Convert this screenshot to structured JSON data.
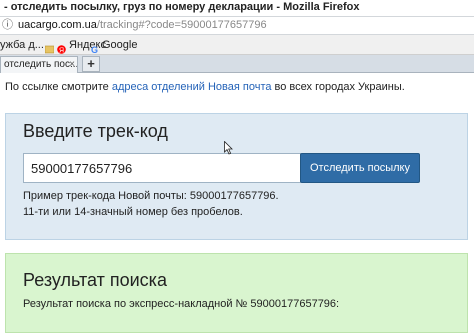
{
  "window": {
    "title": "- отследить посылку, груз по номеру декларации - Mozilla Firefox"
  },
  "address_bar": {
    "host": "uacargo.com.ua",
    "path": "/tracking#?code=59000177657796"
  },
  "bookmarks": {
    "items": [
      {
        "label": "ужба д..."
      },
      {
        "label": "Яндекс"
      },
      {
        "label": "Google"
      }
    ]
  },
  "tabs": {
    "active_label": "отследить пос...",
    "close_glyph": "×",
    "new_tab_glyph": "+"
  },
  "page": {
    "notice_prefix": "По ссылке смотрите ",
    "notice_link": "адреса отделений Новая почта",
    "notice_suffix": " во всех городах Украины.",
    "track": {
      "title": "Введите трек-код",
      "input_value": "59000177657796",
      "button_label": "Отследить посылку",
      "hint_line1": "Пример трек-кода Новой почты: 59000177657796.",
      "hint_line2": "11-ти или 14-значный номер без пробелов."
    },
    "result": {
      "title": "Результат поиска",
      "text": "Результат поиска по экспресс-накладной № 59000177657796:"
    }
  },
  "colors": {
    "track_panel_bg": "#dfeaf3",
    "result_panel_bg": "#d9f5cf",
    "button_bg": "#2f6ca6",
    "link": "#2563b8"
  }
}
